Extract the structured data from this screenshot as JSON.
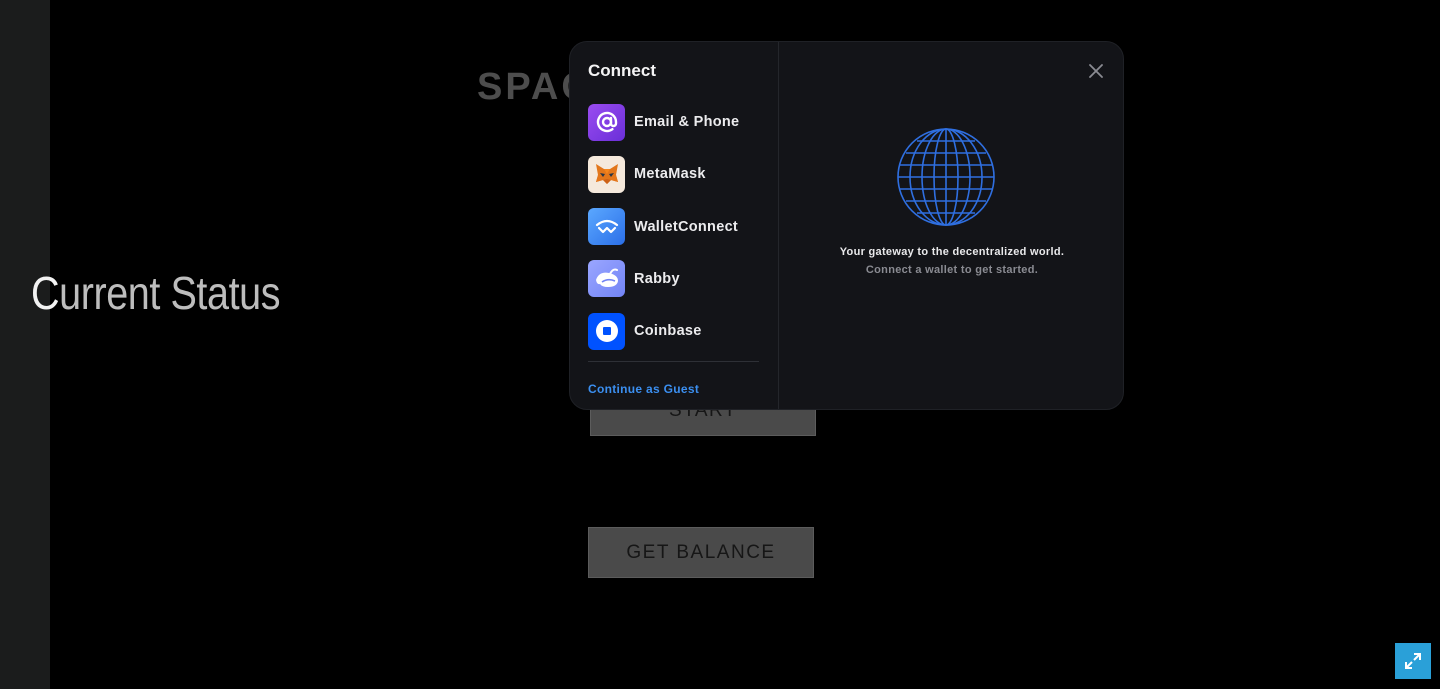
{
  "game": {
    "title": "SPAC",
    "status_heading_first": "C",
    "status_heading_rest": "urrent Status",
    "start_label": "START",
    "balance_label": "GET BALANCE"
  },
  "modal": {
    "title": "Connect",
    "wallets": [
      {
        "label": "Email & Phone",
        "icon": "at-sign-icon",
        "color": "#7b3fe4"
      },
      {
        "label": "MetaMask",
        "icon": "metamask-fox-icon",
        "color": "#f5e9dc"
      },
      {
        "label": "WalletConnect",
        "icon": "walletconnect-icon",
        "color": "#3b99fc"
      },
      {
        "label": "Rabby",
        "icon": "rabby-icon",
        "color": "#8697ff"
      },
      {
        "label": "Coinbase",
        "icon": "coinbase-icon",
        "color": "#0052ff"
      }
    ],
    "guest_label": "Continue as Guest",
    "gateway_title": "Your gateway to the decentralized world.",
    "gateway_subtitle": "Connect a wallet to get started.",
    "accent_color": "#3b8ff0"
  },
  "fullscreen": {
    "icon": "expand-icon",
    "color": "#2aa0d8"
  }
}
